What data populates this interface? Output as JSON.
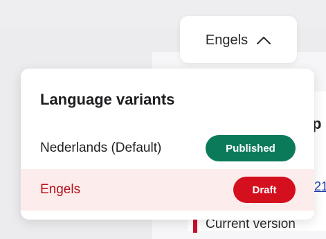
{
  "background": {
    "partial_heading_letter": "p",
    "partial_link_text": "21",
    "current_version_text": "Current version"
  },
  "language_button": {
    "label": "Engels",
    "icon": "chevron-up-icon"
  },
  "popover": {
    "title": "Language variants",
    "variants": [
      {
        "label": "Nederlands (Default)",
        "status": "Published",
        "status_color": "#0b7a5b",
        "selected": false
      },
      {
        "label": "Engels",
        "status": "Draft",
        "status_color": "#d5101e",
        "selected": true
      }
    ]
  },
  "colors": {
    "selected_row_bg": "#fdecec",
    "selected_text": "#b5121b",
    "link": "#1e3aa8"
  }
}
